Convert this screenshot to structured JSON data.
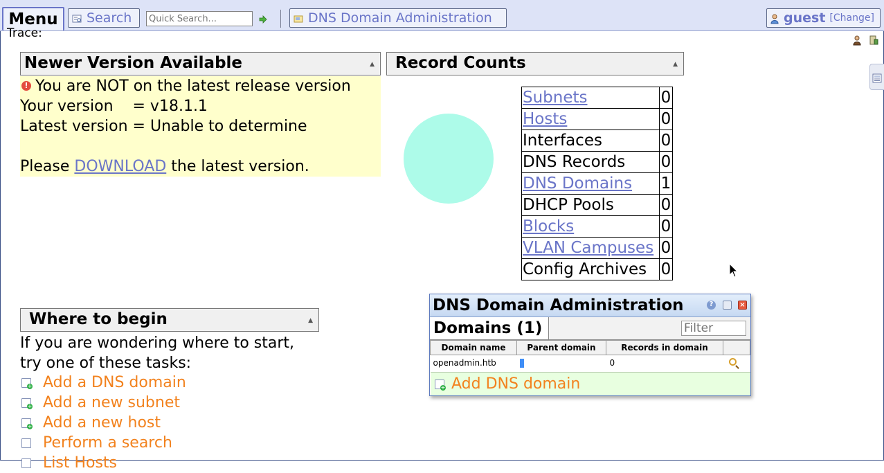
{
  "topbar": {
    "menu_label": "Menu",
    "search_label": "Search",
    "quick_search_placeholder": "Quick Search...",
    "dns_tab_label": "DNS Domain Administration",
    "user_name": "guest",
    "change_label": "[Change]"
  },
  "trace_label": "Trace:",
  "newer_version": {
    "title": "Newer Version Available",
    "warning": "You are NOT on the latest release version",
    "your_version": "Your version    = v18.1.1",
    "latest_version": "Latest version = Unable to determine",
    "please": "Please",
    "download": "DOWNLOAD",
    "suffix": "the latest version."
  },
  "record_counts": {
    "title": "Record Counts",
    "rows": [
      {
        "label": "Subnets",
        "count": "0",
        "link": true
      },
      {
        "label": "Hosts",
        "count": "0",
        "link": true
      },
      {
        "label": "Interfaces",
        "count": "0",
        "link": false
      },
      {
        "label": "DNS Records",
        "count": "0",
        "link": false
      },
      {
        "label": "DNS Domains",
        "count": "1",
        "link": true
      },
      {
        "label": "DHCP Pools",
        "count": "0",
        "link": false
      },
      {
        "label": "Blocks",
        "count": "0",
        "link": true
      },
      {
        "label": "VLAN Campuses",
        "count": "0",
        "link": true
      },
      {
        "label": "Config Archives",
        "count": "0",
        "link": false
      }
    ]
  },
  "where_to_begin": {
    "title": "Where to begin",
    "intro_line1": "If you are wondering where to start,",
    "intro_line2": "try one of these tasks:",
    "tasks": [
      "Add a DNS domain",
      "Add a new subnet",
      "Add a new host",
      "Perform a search",
      "List Hosts"
    ]
  },
  "dns_window": {
    "title": "DNS Domain Administration",
    "domains_title": "Domains (1)",
    "filter_placeholder": "Filter",
    "columns": [
      "Domain name",
      "Parent domain",
      "Records in domain"
    ],
    "rows": [
      {
        "domain": "openadmin.htb",
        "parent": "",
        "records": "0"
      }
    ],
    "add_label": "Add DNS domain"
  },
  "colors": {
    "link": "#6a75c8",
    "task": "#f2821e",
    "notice_bg": "#ffffcc",
    "circle": "#adfbe9"
  }
}
